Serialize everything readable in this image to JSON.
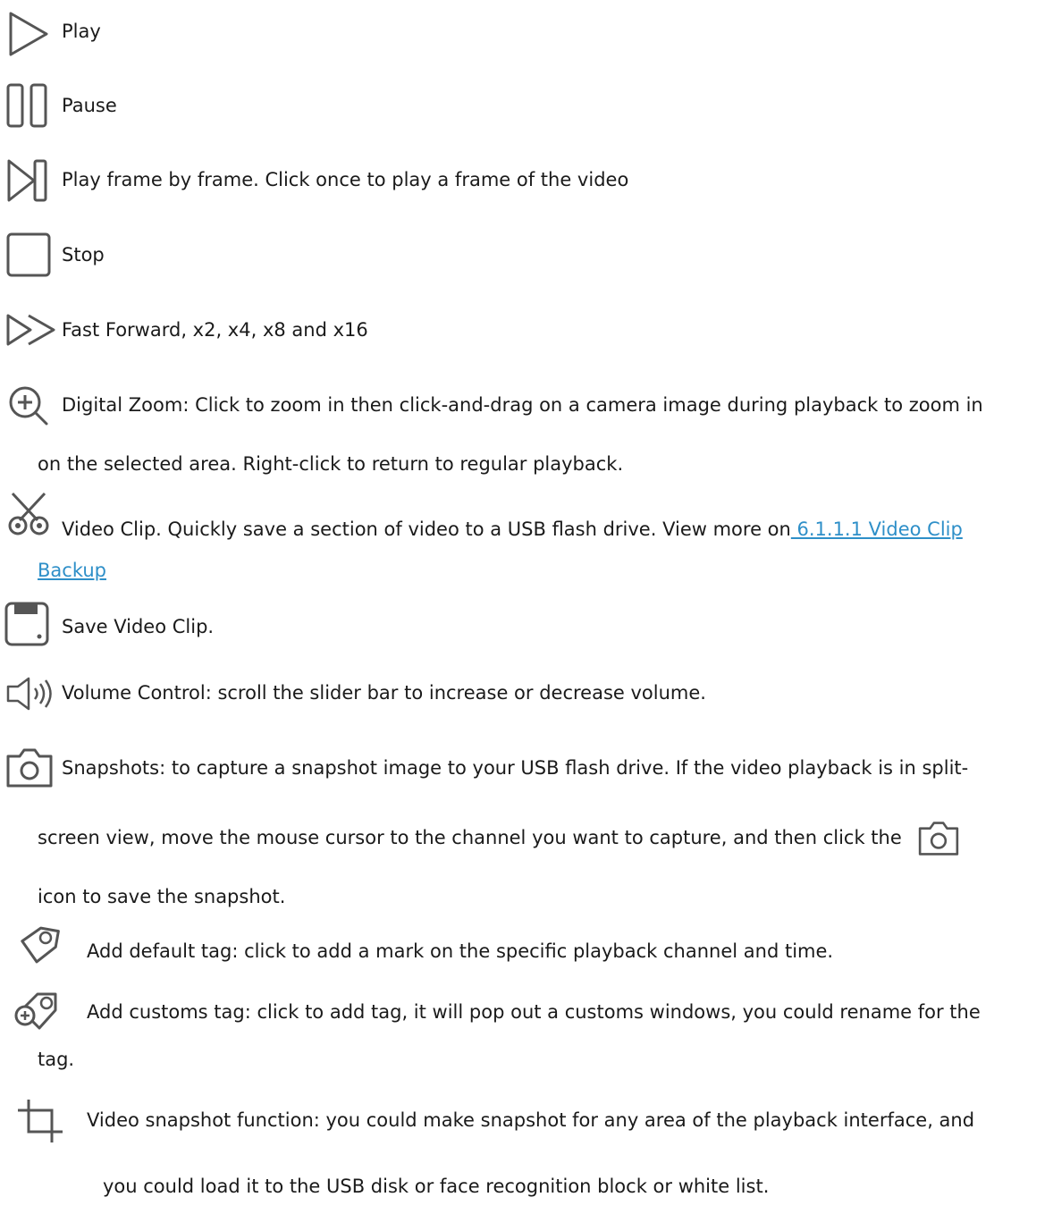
{
  "items": [
    {
      "icon": "play-icon",
      "text": "Play"
    },
    {
      "icon": "pause-icon",
      "text": "Pause"
    },
    {
      "icon": "frame-step-icon",
      "text": "Play frame by frame. Click once to play a frame of the video"
    },
    {
      "icon": "stop-icon",
      "text": "Stop"
    },
    {
      "icon": "fast-forward-icon",
      "text": "Fast Forward, x2, x4, x8 and x16"
    },
    {
      "icon": "zoom-in-icon",
      "text_line1": "Digital Zoom: Click to zoom in then click-and-drag on a camera image during playback to zoom in",
      "text_line2": "on the selected area. Right-click to return to regular playback."
    },
    {
      "icon": "scissors-icon",
      "text": "Video Clip. Quickly save a section of video to a USB flash drive. View more on",
      "link_part1": " 6.1.1.1 Video Clip",
      "link_part2": "Backup"
    },
    {
      "icon": "save-icon",
      "text": "Save Video Clip."
    },
    {
      "icon": "volume-icon",
      "text": "Volume Control: scroll the slider bar to increase or decrease volume."
    },
    {
      "icon": "camera-icon",
      "text_line1": "Snapshots: to capture a snapshot image to your USB flash drive. If the video playback is in split-",
      "text_line2": "screen view, move the mouse cursor to the channel you want to capture, and then click the",
      "text_line3": "icon to save the snapshot."
    },
    {
      "icon": "tag-icon",
      "text": "Add default tag: click to add a mark on the specific playback channel and time."
    },
    {
      "icon": "add-tag-icon",
      "text_line1": "Add customs tag: click to add tag, it will pop out a customs windows, you could rename for the",
      "text_line2": "tag."
    },
    {
      "icon": "crop-icon",
      "text_line1": "Video snapshot function: you could make snapshot for any area of the playback interface, and",
      "text_line2": "you could load it to the USB disk or face recognition block or white list."
    }
  ]
}
